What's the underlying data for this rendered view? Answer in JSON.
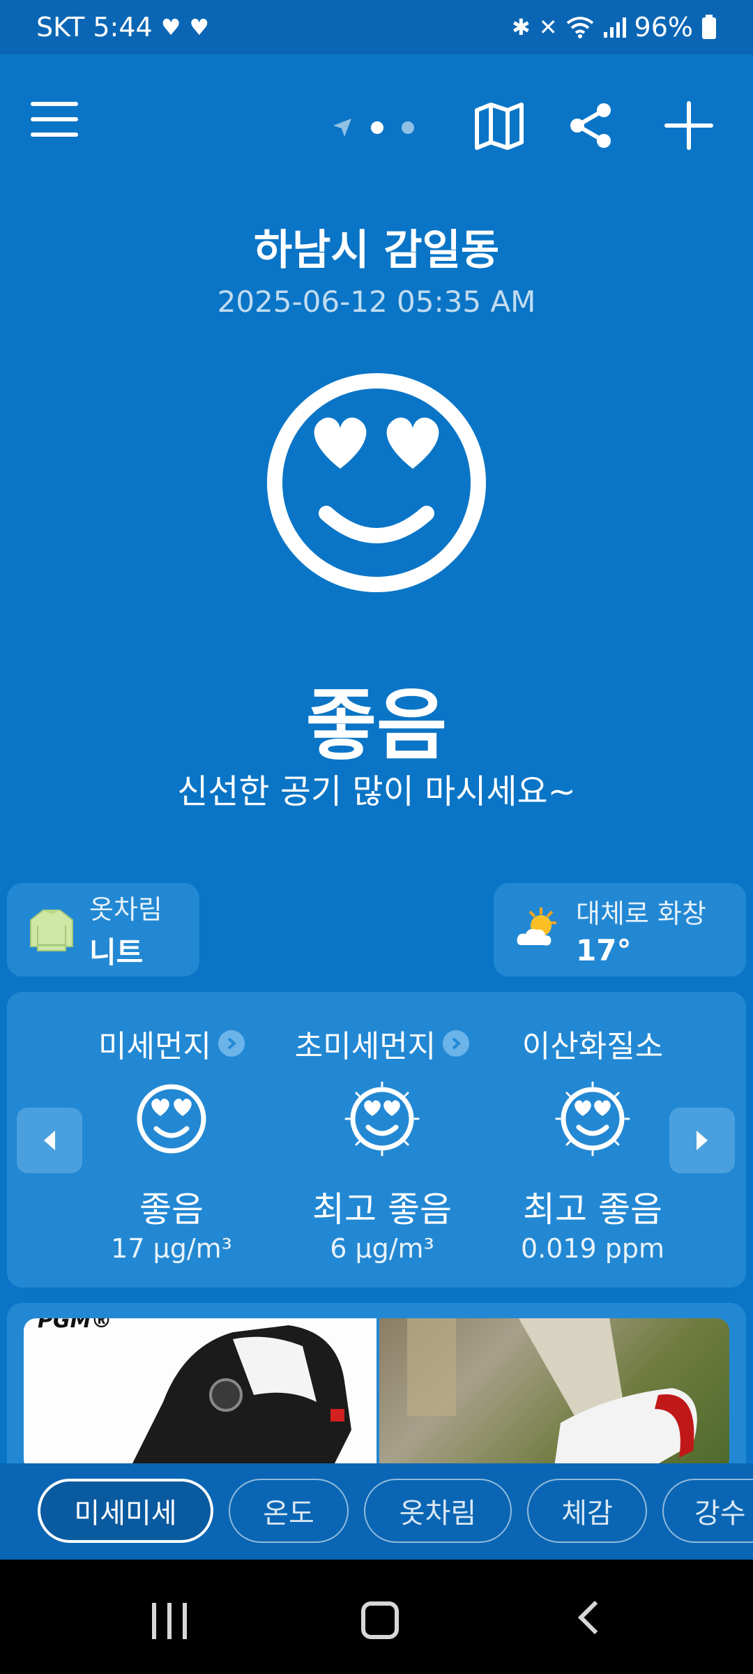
{
  "status_bar": {
    "carrier_time": "SKT 5:44",
    "battery": "96%",
    "left_icons": [
      "health-heart-icon",
      "health-heart-icon"
    ],
    "right_icons": [
      "bluetooth-icon",
      "mute-icon",
      "wifi-icon",
      "signal-icon",
      "battery-icon"
    ]
  },
  "header": {
    "location": "하남시 감일동",
    "timestamp": "2025-06-12 05:35 AM"
  },
  "overall": {
    "grade": "좋음",
    "message": "신선한 공기 많이 마시세요~",
    "face_icon": "heart-eyes-face-icon"
  },
  "clothing": {
    "label": "옷차림",
    "value": "니트",
    "icon": "sweater-icon"
  },
  "weather": {
    "label": "대체로 화창",
    "value": "17°",
    "icon": "partly-sunny-icon"
  },
  "pollutants": [
    {
      "name": "미세먼지",
      "grade": "좋음",
      "value": "17 μg/m³",
      "has_info": true
    },
    {
      "name": "초미세먼지",
      "grade": "최고 좋음",
      "value": "6 μg/m³",
      "has_info": true
    },
    {
      "name": "이산화질소",
      "grade": "최고 좋음",
      "value": "0.019 ppm",
      "has_info": false
    }
  ],
  "ad": {
    "brand_fragment": "PGM®"
  },
  "tabs": [
    {
      "label": "미세미세",
      "active": true
    },
    {
      "label": "온도",
      "active": false
    },
    {
      "label": "옷차림",
      "active": false
    },
    {
      "label": "체감",
      "active": false
    },
    {
      "label": "강수",
      "active": false
    }
  ],
  "colors": {
    "background": "#0a75c6",
    "card": "#2388d3",
    "bar": "#0a66b4"
  }
}
